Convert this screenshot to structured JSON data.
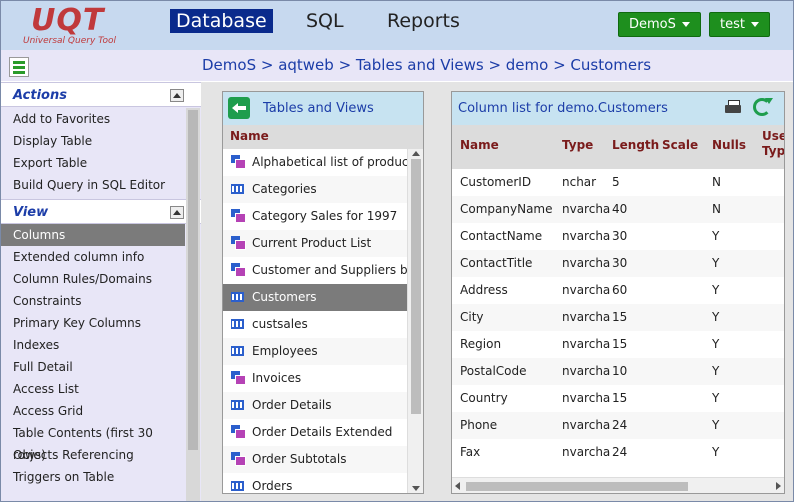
{
  "header": {
    "logo": "UQT",
    "logo_subtitle": "Universal Query Tool",
    "menu": [
      {
        "label": "Database",
        "active": true
      },
      {
        "label": "SQL",
        "active": false
      },
      {
        "label": "Reports",
        "active": false
      }
    ],
    "connection_button": "DemoS",
    "user_button": "test"
  },
  "breadcrumb": "DemoS > aqtweb > Tables and Views > demo > Customers",
  "sidebar": {
    "actions_title": "Actions",
    "actions": [
      "Add to Favorites",
      "Display Table",
      "Export Table",
      "Build Query in SQL Editor"
    ],
    "view_title": "View",
    "view_items": [
      "Columns",
      "Extended column info",
      "Column Rules/Domains",
      "Constraints",
      "Primary Key Columns",
      "Indexes",
      "Full Detail",
      "Access List",
      "Access Grid",
      "Table Contents (first 30 rows)",
      "Objects Referencing",
      "Triggers on Table"
    ],
    "selected": "Columns"
  },
  "tables_panel": {
    "title": "Tables and Views",
    "column_header": "Name",
    "items": [
      {
        "name": "Alphabetical list of products",
        "icon": "view-icon"
      },
      {
        "name": "Categories",
        "icon": "table-icon"
      },
      {
        "name": "Category Sales for 1997",
        "icon": "view-icon"
      },
      {
        "name": "Current Product List",
        "icon": "view-icon"
      },
      {
        "name": "Customer and Suppliers by City",
        "icon": "view-icon"
      },
      {
        "name": "Customers",
        "icon": "table-icon"
      },
      {
        "name": "custsales",
        "icon": "table-icon"
      },
      {
        "name": "Employees",
        "icon": "table-icon"
      },
      {
        "name": "Invoices",
        "icon": "view-icon"
      },
      {
        "name": "Order Details",
        "icon": "table-icon"
      },
      {
        "name": "Order Details Extended",
        "icon": "view-icon"
      },
      {
        "name": "Order Subtotals",
        "icon": "view-icon"
      },
      {
        "name": "Orders",
        "icon": "table-icon"
      }
    ],
    "selected": "Customers"
  },
  "columns_panel": {
    "title": "Column list for demo.Customers",
    "headers": [
      "Name",
      "Type",
      "Length",
      "Scale",
      "Nulls",
      "User Type"
    ],
    "rows": [
      [
        "CustomerID",
        "nchar",
        "5",
        "",
        "N"
      ],
      [
        "CompanyName",
        "nvarchar",
        "40",
        "",
        "N"
      ],
      [
        "ContactName",
        "nvarchar",
        "30",
        "",
        "Y"
      ],
      [
        "ContactTitle",
        "nvarchar",
        "30",
        "",
        "Y"
      ],
      [
        "Address",
        "nvarchar",
        "60",
        "",
        "Y"
      ],
      [
        "City",
        "nvarchar",
        "15",
        "",
        "Y"
      ],
      [
        "Region",
        "nvarchar",
        "15",
        "",
        "Y"
      ],
      [
        "PostalCode",
        "nvarchar",
        "10",
        "",
        "Y"
      ],
      [
        "Country",
        "nvarchar",
        "15",
        "",
        "Y"
      ],
      [
        "Phone",
        "nvarchar",
        "24",
        "",
        "Y"
      ],
      [
        "Fax",
        "nvarchar",
        "24",
        "",
        "Y"
      ]
    ]
  }
}
